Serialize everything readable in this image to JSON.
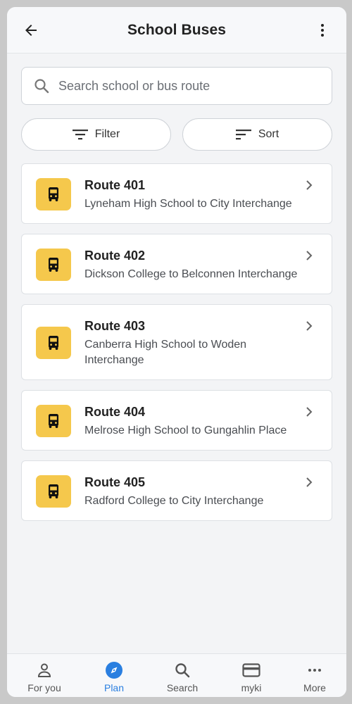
{
  "header": {
    "title": "School Buses",
    "back_icon": "arrow-left-icon",
    "menu_icon": "more-vertical-icon"
  },
  "search": {
    "placeholder": "Search school or bus route",
    "value": "",
    "icon": "search-icon"
  },
  "filters": {
    "filter_label": "Filter",
    "sort_label": "Sort"
  },
  "routes": [
    {
      "name": "Route 401",
      "description": "Lyneham High School to City Interchange"
    },
    {
      "name": "Route 402",
      "description": "Dickson College to Belconnen Interchange"
    },
    {
      "name": "Route 403",
      "description": "Canberra High School to Woden Interchange"
    },
    {
      "name": "Route 404",
      "description": "Melrose High School to Gungahlin Place"
    },
    {
      "name": "Route 405",
      "description": "Radford College to City Interchange"
    }
  ],
  "bottom_nav": {
    "items": [
      {
        "label": "For you",
        "icon": "person-icon"
      },
      {
        "label": "Plan",
        "icon": "compass-icon",
        "active": true
      },
      {
        "label": "Search",
        "icon": "search-icon"
      },
      {
        "label": "myki",
        "icon": "card-icon"
      },
      {
        "label": "More",
        "icon": "more-horizontal-icon"
      }
    ]
  },
  "colors": {
    "accent": "#2a7fe0",
    "bus_badge": "#f5c84c",
    "background": "#f3f4f6"
  }
}
